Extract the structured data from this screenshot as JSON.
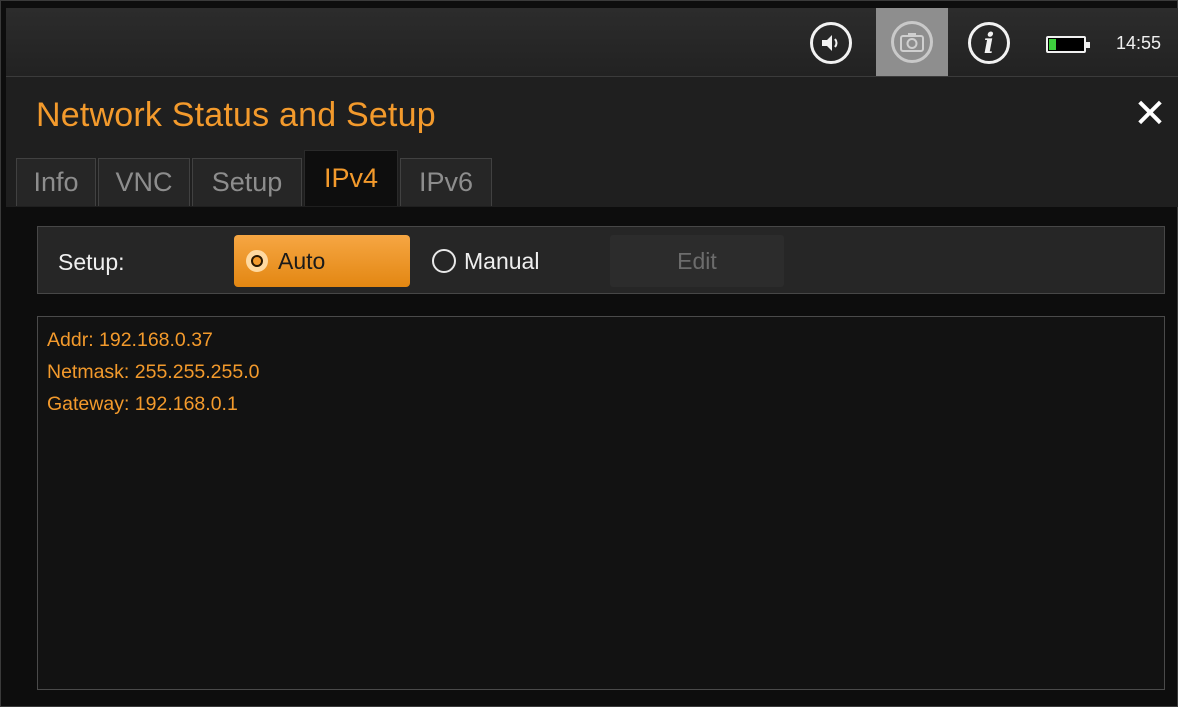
{
  "statusbar": {
    "icons": [
      "speaker-icon",
      "camera-icon",
      "info-icon",
      "battery-icon"
    ],
    "time": "14:55",
    "battery_level": 0.2,
    "battery_color": "#3ecf3e"
  },
  "header": {
    "title": "Network Status and Setup",
    "close_symbol": "✕"
  },
  "tabs": [
    {
      "label": "Info",
      "active": false
    },
    {
      "label": "VNC",
      "active": false
    },
    {
      "label": "Setup",
      "active": false
    },
    {
      "label": "IPv4",
      "active": true
    },
    {
      "label": "IPv6",
      "active": false
    }
  ],
  "setup": {
    "label": "Setup:",
    "options": [
      {
        "label": "Auto",
        "selected": true
      },
      {
        "label": "Manual",
        "selected": false
      }
    ],
    "edit_label": "Edit",
    "edit_enabled": false
  },
  "info": {
    "lines": [
      "Addr: 192.168.0.37",
      "Netmask: 255.255.255.0",
      "Gateway: 192.168.0.1"
    ]
  },
  "colors": {
    "accent": "#f39a2c",
    "background": "#0d0d0d"
  }
}
